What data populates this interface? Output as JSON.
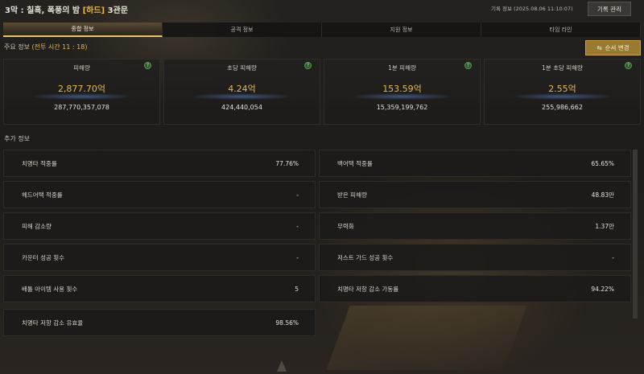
{
  "header": {
    "title_prefix": "3막 : 칠흑, 폭풍의 밤",
    "difficulty": "[하드]",
    "title_suffix": "3관문",
    "record_info": "기록 정보 (2025.08.06 11:10:07)",
    "record_manage_label": "기록 관리"
  },
  "tabs": [
    "종합 정보",
    "공격 정보",
    "지원 정보",
    "타임 라인"
  ],
  "main_info": {
    "label": "주요 정보",
    "battle_time": "(전투 시간 11 : 18)",
    "order_change_label": "순서 변경"
  },
  "stats": [
    {
      "label": "피해량",
      "main": "2,877.70억",
      "sub": "287,770,357,078"
    },
    {
      "label": "초당 피해량",
      "main": "4.24억",
      "sub": "424,440,054"
    },
    {
      "label": "1분 피해량",
      "main": "153.59억",
      "sub": "15,359,199,762"
    },
    {
      "label": "1분 초당 피해량",
      "main": "2.55억",
      "sub": "255,986,662"
    }
  ],
  "extra_info": {
    "label": "추가 정보",
    "left": [
      {
        "label": "치명타 적중률",
        "value": "77.76%"
      },
      {
        "label": "헤드어택 적중률",
        "value": "-"
      },
      {
        "label": "피해 감소량",
        "value": "-"
      },
      {
        "label": "카운터 성공 횟수",
        "value": "-"
      },
      {
        "label": "배틀 아이템 사용 횟수",
        "value": "5"
      },
      {
        "label": "치명타 저항 감소 유효율",
        "value": "98.56%"
      }
    ],
    "right": [
      {
        "label": "백어택 적중률",
        "value": "65.65%"
      },
      {
        "label": "받은 피해량",
        "value": "48.83만"
      },
      {
        "label": "무력화",
        "value": "1.37만"
      },
      {
        "label": "저스트 가드 성공 횟수",
        "value": "-"
      },
      {
        "label": "치명타 저항 감소 가동률",
        "value": "94.22%"
      }
    ]
  }
}
